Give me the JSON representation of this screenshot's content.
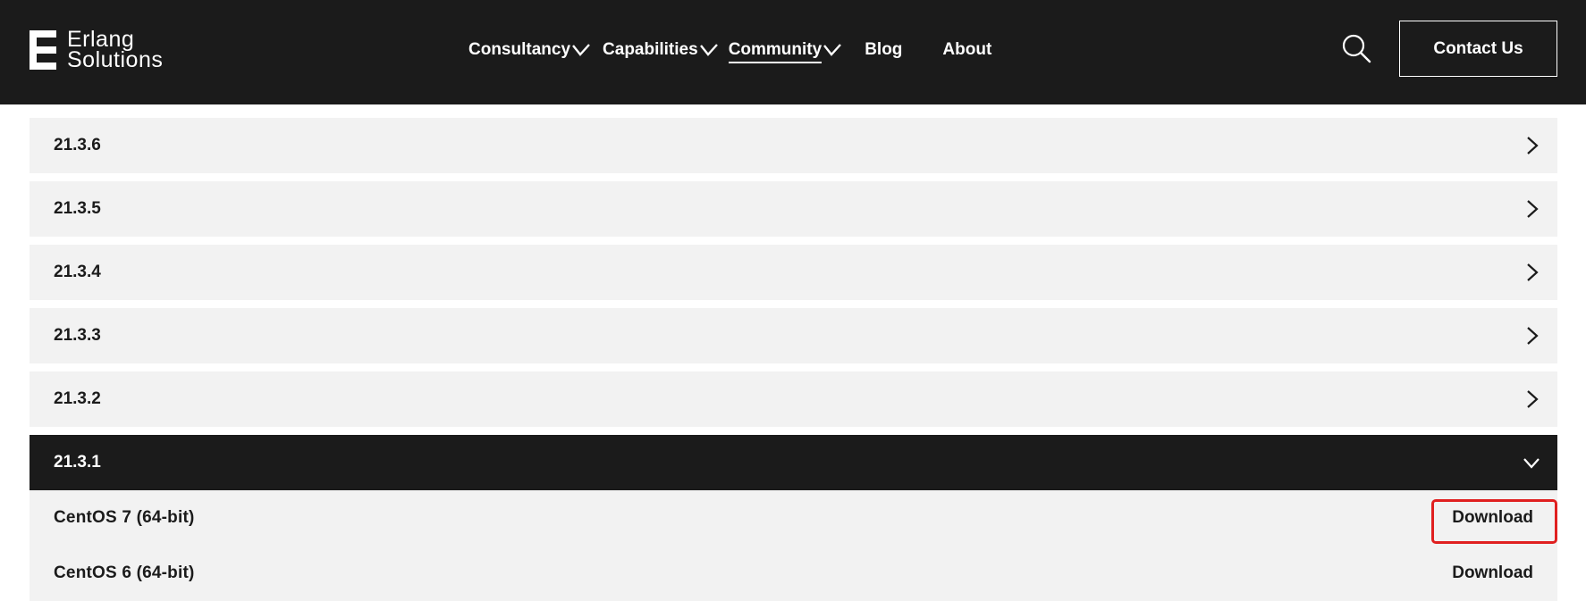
{
  "header": {
    "logo": {
      "line1": "Erlang",
      "line2": "Solutions"
    },
    "nav": [
      {
        "label": "Consultancy",
        "has_dropdown": true,
        "active": false
      },
      {
        "label": "Capabilities",
        "has_dropdown": true,
        "active": false
      },
      {
        "label": "Community",
        "has_dropdown": true,
        "active": true
      },
      {
        "label": "Blog",
        "has_dropdown": false,
        "active": false
      },
      {
        "label": "About",
        "has_dropdown": false,
        "active": false
      }
    ],
    "search_icon": "search-icon",
    "contact_label": "Contact Us"
  },
  "accordion": {
    "collapsed": [
      {
        "version": "21.3.6"
      },
      {
        "version": "21.3.5"
      },
      {
        "version": "21.3.4"
      },
      {
        "version": "21.3.3"
      },
      {
        "version": "21.3.2"
      }
    ],
    "open": {
      "version": "21.3.1",
      "downloads": [
        {
          "os": "CentOS 7 (64-bit)",
          "action": "Download",
          "highlighted": true
        },
        {
          "os": "CentOS 6 (64-bit)",
          "action": "Download",
          "highlighted": false
        }
      ]
    }
  },
  "colors": {
    "header_bg": "#1b1b1b",
    "row_bg": "#f2f2f2",
    "open_row_bg": "#1b1b1b",
    "highlight": "#e02020"
  }
}
